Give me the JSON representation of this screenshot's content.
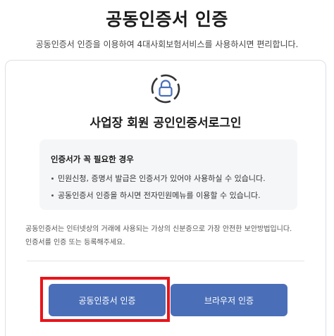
{
  "header": {
    "title": "공동인증서 인증",
    "subtitle": "공동인증서 인증을 이용하여 4대사회보험서비스를 사용하시면 편리합니다."
  },
  "card": {
    "icon": "lock-icon",
    "title": "사업장 회원 공인인증서로그인",
    "info": {
      "title": "인증서가 꼭 필요한 경우",
      "items": [
        "민원신청, 증명서 발급은 인증서가 있어야 사용하실 수 있습니다.",
        "공동인증서 인증을 하시면 전자민원메뉴를 이용할 수 있습니다."
      ]
    },
    "description_line1": "공동인증서는 인터넷상의 거래에 사용되는 가상의 신분증으로 가장 안전한 보안방법입니다.",
    "description_line2": "인증서를 인증 또는 등록해주세요.",
    "buttons": {
      "cert_label": "공동인증서 인증",
      "browser_label": "브라우저 인증"
    }
  },
  "colors": {
    "button": "#4a6fb8",
    "highlight": "#e8141a",
    "info_bg": "#f5f6f8",
    "icon_ring": "#333333",
    "lock": "#4a6fb8"
  }
}
